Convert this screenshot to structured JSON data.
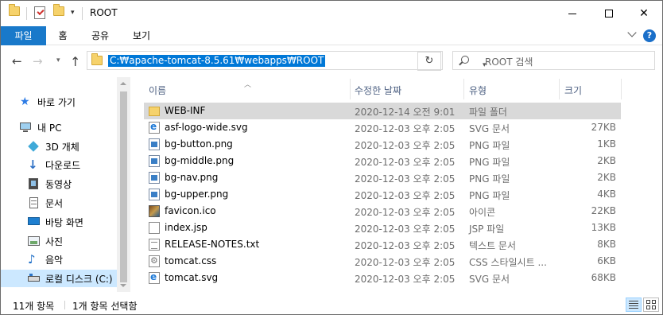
{
  "window": {
    "title": "ROOT",
    "minimize_label": "",
    "maximize_label": "",
    "close_label": "✕"
  },
  "ribbon": {
    "tabs": [
      "파일",
      "홈",
      "공유",
      "보기"
    ]
  },
  "nav": {
    "address": "C:₩apache-tomcat-8.5.61₩webapps₩ROOT",
    "search_placeholder": "ROOT 검색",
    "refresh_glyph": "↻"
  },
  "sidebar": {
    "items": [
      {
        "label": "바로 가기",
        "icon": "star-icon"
      },
      {
        "label": "내 PC",
        "icon": "pc-icon"
      },
      {
        "label": "3D 개체",
        "icon": "cube-icon"
      },
      {
        "label": "다운로드",
        "icon": "download-icon"
      },
      {
        "label": "동영상",
        "icon": "video-icon"
      },
      {
        "label": "문서",
        "icon": "documents-icon"
      },
      {
        "label": "바탕 화면",
        "icon": "desktop-icon"
      },
      {
        "label": "사진",
        "icon": "pictures-icon"
      },
      {
        "label": "음악",
        "icon": "music-icon"
      },
      {
        "label": "로컬 디스크 (C:)",
        "icon": "drive-icon"
      }
    ]
  },
  "columns": {
    "name": "이름",
    "date": "수정한 날짜",
    "type": "유형",
    "size": "크기"
  },
  "files": [
    {
      "name": "WEB-INF",
      "date": "2020-12-14 오전 9:01",
      "type": "파일 폴더",
      "size": "",
      "icon": "folder-icon"
    },
    {
      "name": "asf-logo-wide.svg",
      "date": "2020-12-03 오후 2:05",
      "type": "SVG 문서",
      "size": "27KB",
      "icon": "svg-file-icon"
    },
    {
      "name": "bg-button.png",
      "date": "2020-12-03 오후 2:05",
      "type": "PNG 파일",
      "size": "1KB",
      "icon": "png-file-icon"
    },
    {
      "name": "bg-middle.png",
      "date": "2020-12-03 오후 2:05",
      "type": "PNG 파일",
      "size": "2KB",
      "icon": "png-file-icon"
    },
    {
      "name": "bg-nav.png",
      "date": "2020-12-03 오후 2:05",
      "type": "PNG 파일",
      "size": "2KB",
      "icon": "png-file-icon"
    },
    {
      "name": "bg-upper.png",
      "date": "2020-12-03 오후 2:05",
      "type": "PNG 파일",
      "size": "4KB",
      "icon": "png-file-icon"
    },
    {
      "name": "favicon.ico",
      "date": "2020-12-03 오후 2:05",
      "type": "아이콘",
      "size": "22KB",
      "icon": "ico-file-icon"
    },
    {
      "name": "index.jsp",
      "date": "2020-12-03 오후 2:05",
      "type": "JSP 파일",
      "size": "13KB",
      "icon": "doc-file-icon"
    },
    {
      "name": "RELEASE-NOTES.txt",
      "date": "2020-12-03 오후 2:05",
      "type": "텍스트 문서",
      "size": "8KB",
      "icon": "txt-file-icon"
    },
    {
      "name": "tomcat.css",
      "date": "2020-12-03 오후 2:05",
      "type": "CSS 스타일시트 ...",
      "size": "6KB",
      "icon": "css-file-icon"
    },
    {
      "name": "tomcat.svg",
      "date": "2020-12-03 오후 2:05",
      "type": "SVG 문서",
      "size": "68KB",
      "icon": "svg-file-icon"
    }
  ],
  "status": {
    "count": "11개 항목",
    "selection": "1개 항목 선택함"
  },
  "colors": {
    "accent": "#1979ca",
    "selection": "#d9d9d9",
    "sidebar_selection": "#cce8ff",
    "address_highlight": "#0078d7"
  }
}
